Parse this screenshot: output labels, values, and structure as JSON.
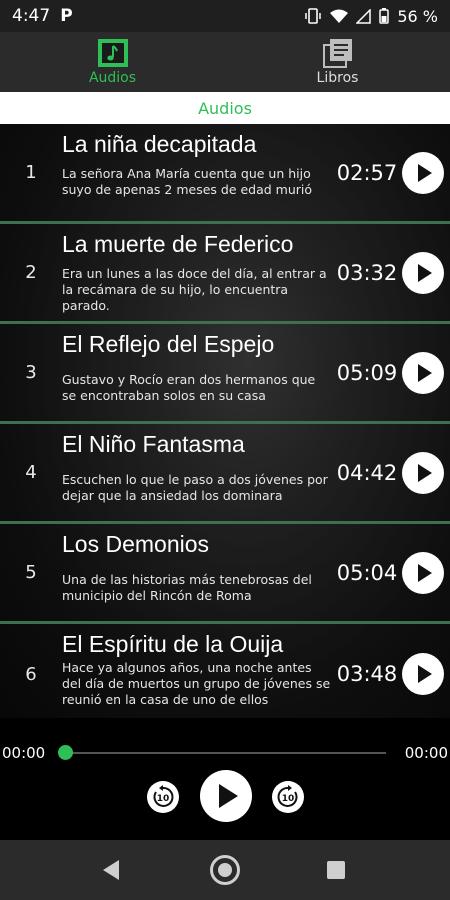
{
  "status_bar": {
    "time": "4:47",
    "app_badge": "P",
    "battery": "56 %"
  },
  "tabs": [
    {
      "label": "Audios",
      "icon": "music-note-icon",
      "active": true
    },
    {
      "label": "Libros",
      "icon": "library-icon",
      "active": false
    }
  ],
  "section_title": "Audios",
  "tracks": [
    {
      "num": "1",
      "title": "La niña decapitada",
      "desc": "La señora Ana María cuenta que un hijo suyo de apenas 2 meses de edad murió",
      "duration": "02:57"
    },
    {
      "num": "2",
      "title": "La muerte de Federico",
      "desc": "Era un lunes a las doce del día, al entrar a la recámara de su hijo, lo encuentra parado.",
      "duration": "03:32"
    },
    {
      "num": "3",
      "title": "El Reflejo del Espejo",
      "desc": "Gustavo y Rocío eran dos hermanos que se encontraban solos en su casa",
      "duration": "05:09"
    },
    {
      "num": "4",
      "title": "El Niño Fantasma",
      "desc": "Escuchen lo que le paso a dos jóvenes por dejar que la ansiedad los dominara",
      "duration": "04:42"
    },
    {
      "num": "5",
      "title": "Los Demonios",
      "desc": "Una de las historias más tenebrosas del municipio del Rincón de Roma",
      "duration": "05:04"
    },
    {
      "num": "6",
      "title": "El Espíritu de la Ouija",
      "desc": "Hace ya algunos años, una noche antes del día de muertos un grupo de jóvenes se reunió en la casa de uno de ellos",
      "duration": "03:48"
    }
  ],
  "player": {
    "elapsed": "00:00",
    "total": "00:00",
    "progress": 0,
    "skip_seconds": "10"
  },
  "colors": {
    "accent": "#2fbf57",
    "row_divider": "#3f6f4e",
    "tab_bg": "#2b2b2b"
  }
}
